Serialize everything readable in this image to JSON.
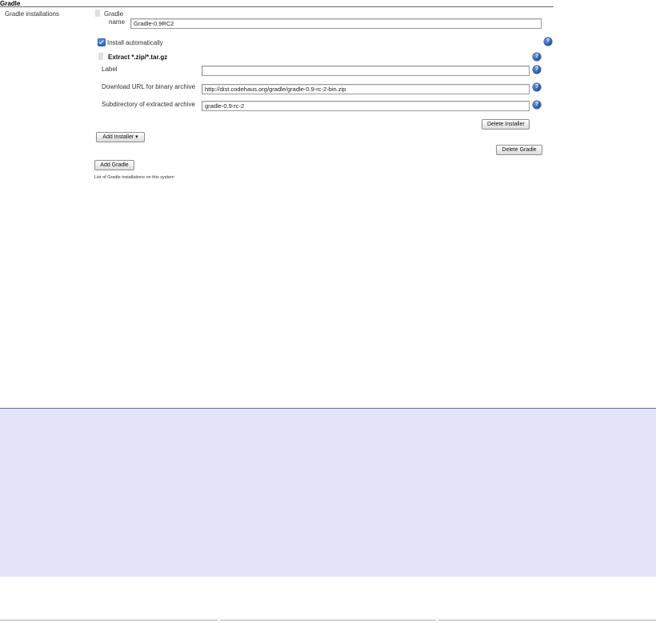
{
  "section": {
    "title": "Gradle"
  },
  "installations": {
    "label": "Gradle installations",
    "gradle_header": "Gradle",
    "name_label": "name",
    "name_value": "Gradle-0.9RC2",
    "install_auto_label": "Install automatically",
    "install_auto_checked": true,
    "installer": {
      "title": "Extract *.zip/*.tar.gz",
      "label_field_label": "Label",
      "label_field_value": "",
      "url_label": "Download URL for binary archive",
      "url_value": "http://dist.codehaus.org/gradle/gradle-0.9-rc-2-bin.zip",
      "subdir_label": "Subdirectory of extracted archive",
      "subdir_value": "gradle-0.9-rc-2",
      "delete_installer_label": "Delete Installer"
    },
    "add_installer_label": "Add Installer",
    "add_installer_caret": "▾",
    "delete_gradle_label": "Delete Gradle",
    "add_gradle_label": "Add Gradle",
    "caption": "List of Gradle installations on this system"
  },
  "icons": {
    "help": "help-icon",
    "grip": "drag-handle-icon"
  },
  "colors": {
    "panel_bg": "#e3e4f7",
    "panel_border": "#6d6f9c",
    "help_blue": "#1f4fa8"
  }
}
